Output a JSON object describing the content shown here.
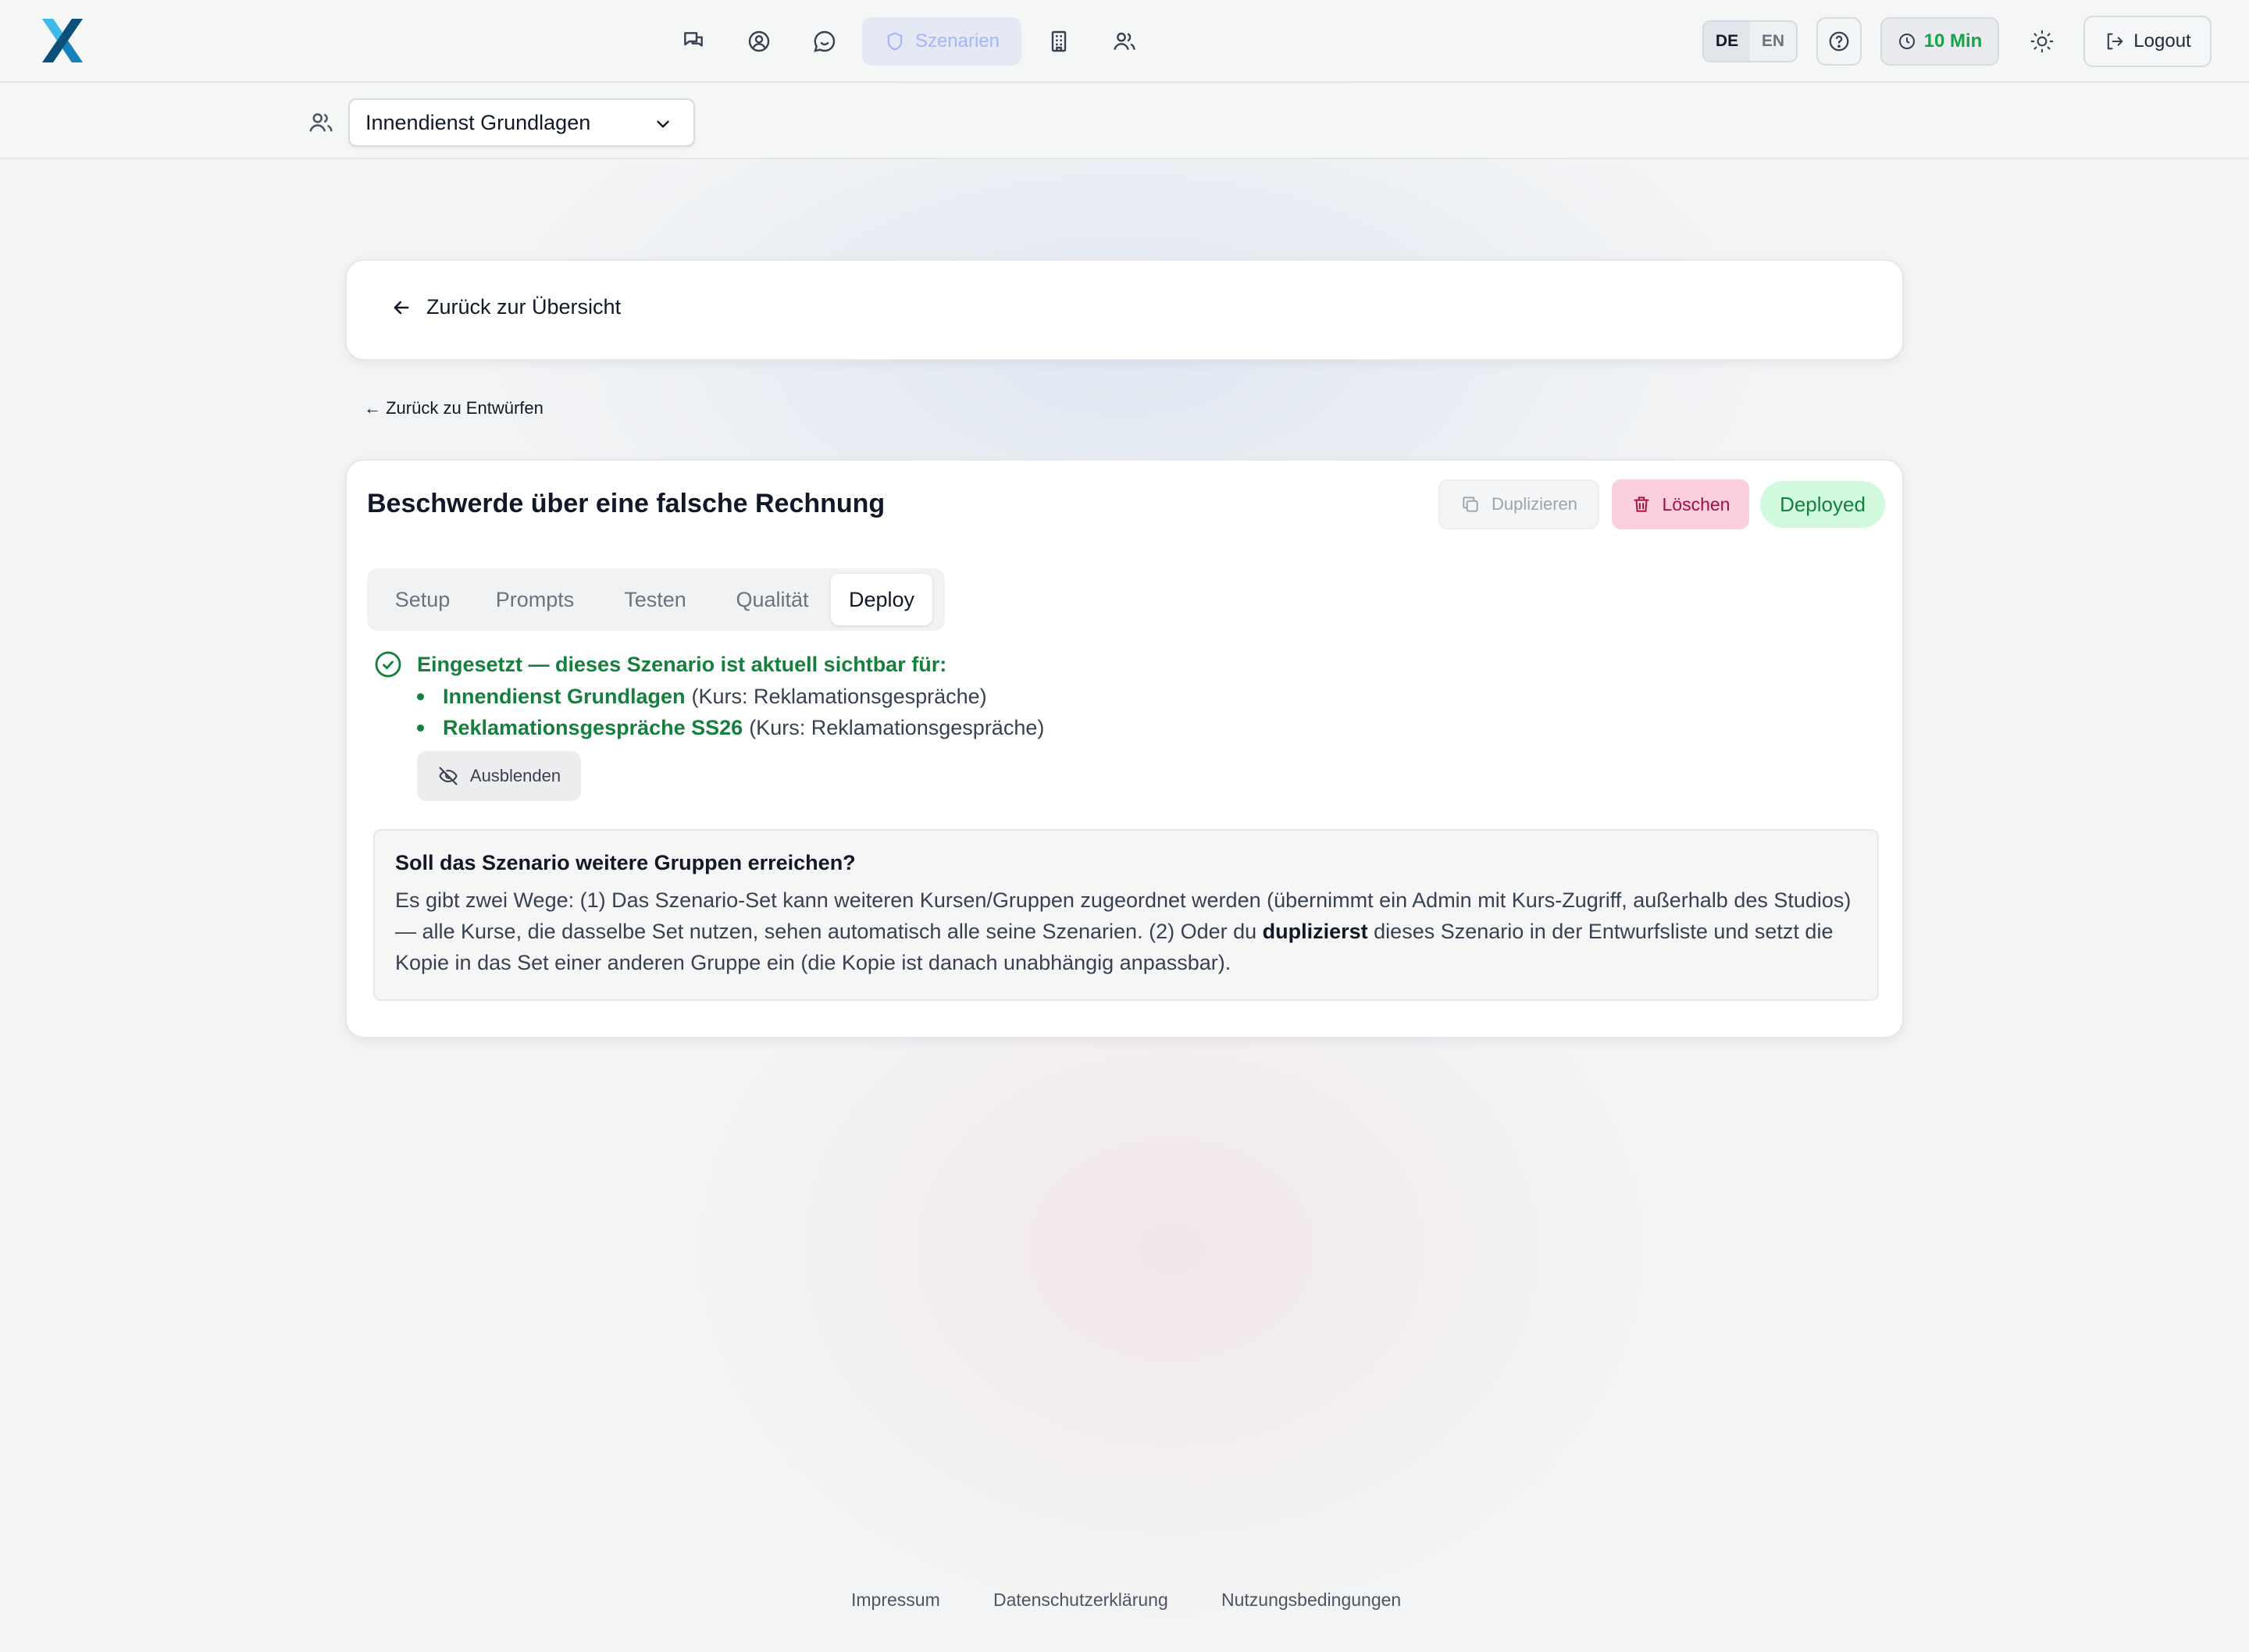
{
  "app": {
    "logo_icon": "brand-x-logo",
    "nav": [
      {
        "icon": "chat-bubbles-icon"
      },
      {
        "icon": "user-circle-icon"
      },
      {
        "icon": "message-circle-icon"
      },
      {
        "icon": "shield-icon",
        "label": "Szenarien",
        "active": true
      },
      {
        "icon": "building-icon"
      },
      {
        "icon": "users-icon"
      }
    ],
    "lang": {
      "de": "DE",
      "en": "EN",
      "selected": "DE"
    },
    "timer_label": "10 Min",
    "logout_label": "Logout"
  },
  "group_selector": {
    "value": "Innendienst Grundlagen"
  },
  "back_card": {
    "label": "Zurück zur Übersicht"
  },
  "drafts_link": "← Zurück zu Entwürfen",
  "scenario": {
    "title": "Beschwerde über eine falsche Rechnung",
    "duplicate_label": "Duplizieren",
    "delete_label": "Löschen",
    "status": "Deployed",
    "tabs": [
      "Setup",
      "Prompts",
      "Testen",
      "Qualität",
      "Deploy"
    ],
    "active_tab": "Deploy",
    "deployed_heading": "Eingesetzt — dieses Szenario ist aktuell sichtbar für:",
    "groups": [
      {
        "name": "Innendienst Grundlagen",
        "course": "(Kurs: Reklamationsgespräche)"
      },
      {
        "name": "Reklamationsgespräche SS26",
        "course": "(Kurs: Reklamationsgespräche)"
      }
    ],
    "hide_label": "Ausblenden",
    "info": {
      "title": "Soll das Szenario weitere Gruppen erreichen?",
      "text_part1": "Es gibt zwei Wege: (1) Das Szenario-Set kann weiteren Kursen/Gruppen zugeordnet werden (übernimmt ein Admin mit Kurs-Zugriff, außerhalb des Studios) — alle Kurse, die dasselbe Set nutzen, sehen automatisch alle seine Szenarien. (2) Oder du ",
      "text_bold": "duplizierst",
      "text_part2": " dieses Szenario in der Entwurfsliste und setzt die Kopie in das Set einer anderen Gruppe ein (die Kopie ist danach unabhängig anpassbar)."
    }
  },
  "footer": {
    "impressum": "Impressum",
    "datenschutz": "Datenschutzerklärung",
    "nutzung": "Nutzungsbedingungen"
  },
  "colors": {
    "accent_green": "#15803d",
    "delete_bg": "#fbcfe0",
    "status_bg": "#d1fadf",
    "nav_active_bg": "#e5e9f3",
    "nav_active_fg": "#a5b4fc"
  }
}
